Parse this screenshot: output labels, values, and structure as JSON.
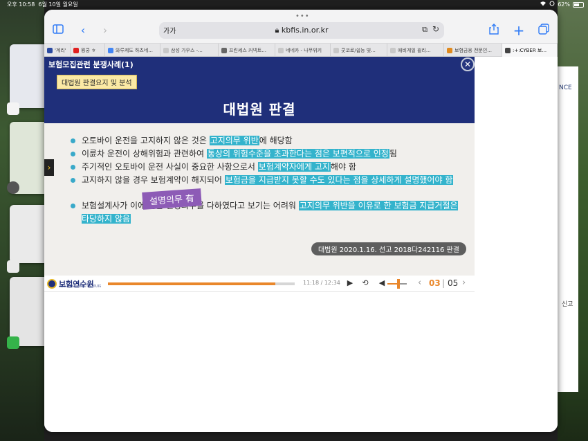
{
  "status": {
    "time": "오후 10:58",
    "date": "6월 10일 월요일",
    "battery": "62%",
    "battery_level": 0.62
  },
  "browser": {
    "address_prefix": "가가",
    "url": "kbfis.in.or.kr",
    "tabs": [
      {
        "label": "'계리'",
        "color": "#2b4aa0"
      },
      {
        "label": "뭥쿵 ㅎ",
        "color": "#e02020"
      },
      {
        "label": "와루케도 하츠네...",
        "color": "#4285f4"
      },
      {
        "label": "삼성 가우스 -...",
        "color": "#c8c8c8"
      },
      {
        "label": "프린세스 커넥트...",
        "color": "#666666"
      },
      {
        "label": "네네카 - 나무위키",
        "color": "#c8c8c8"
      },
      {
        "label": "쿳코로/쉽능 빛...",
        "color": "#c8c8c8"
      },
      {
        "label": "애비게일 윌리...",
        "color": "#c8c8c8"
      },
      {
        "label": "보험금융 전문인...",
        "color": "#e08a1e"
      },
      {
        "label": ":+:CYBER 보...",
        "color": "#444444",
        "active": true
      }
    ]
  },
  "slide": {
    "category": "보험모집관련 분쟁사례(1)",
    "tag": "대법원 판결요지 및 분석",
    "title": "대법원 판결",
    "bullets": [
      {
        "pre": "오토바이 운전을 고지하지 않은 것은 ",
        "hl": "고지의무 위반",
        "post": "에 해당함"
      },
      {
        "pre": "이륜차 운전이 상해위험과 관련하여 ",
        "hl": "통상의 위험수준을 초과한다는 점은 보편적으로 인정",
        "post": "됨"
      },
      {
        "pre": "주기적인 오토바이 운전 사실이 중요한 사항으로서 ",
        "hl": "보험계약자에게 고지",
        "post": "해야 함"
      },
      {
        "pre": "고지하지 않을 경우 보험계약이 해지되어 ",
        "hl": "보험금을 지급받지 못할 수도 있다는 점을 상세하게 설명했어야 함",
        "post": ""
      },
      {
        "pre": "보험설계사가 이에 관한 설명의무를 다하였다고 보기는 어려워 ",
        "hl": "고지의무 위반을 이유로 한 보험금 지급거절은 타당하지 않음",
        "post": ""
      }
    ],
    "stamp": "설명의무 有",
    "citation": "대법원 2020.1.16. 선고 2018다242116 판결"
  },
  "player": {
    "logo": "보험연수원",
    "logo_sub": "KOREA INSURANCE INSTITUTE",
    "time": "11:18 / 12:34",
    "progress": 0.895,
    "volume": 0.5,
    "page_current": "03",
    "page_total": "05"
  },
  "background": {
    "right_text_1": "NCE",
    "right_text_2": "신고"
  },
  "colors": {
    "accent": "#e9872b",
    "slide_header": "#1f2f7a",
    "highlight": "#34b3cc",
    "stamp": "#8d5bb6"
  }
}
